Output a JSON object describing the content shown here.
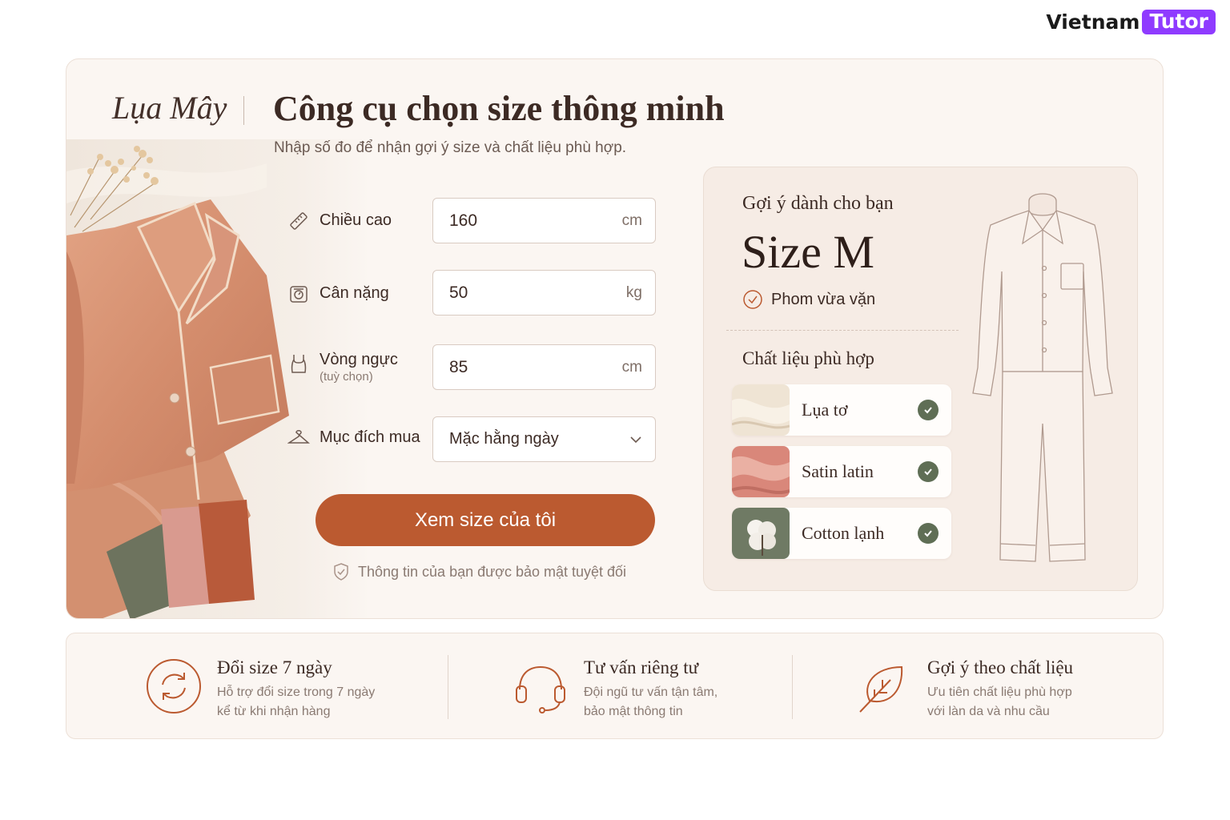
{
  "watermark": {
    "part1": "Vietnam",
    "part2": "Tutor"
  },
  "brand": "Lụa Mây",
  "header": {
    "title": "Công cụ chọn size thông minh",
    "subtitle": "Nhập số đo để nhận gợi ý size và chất liệu phù hợp."
  },
  "form": {
    "height": {
      "label": "Chiều cao",
      "value": "160",
      "unit": "cm",
      "icon": "ruler-icon"
    },
    "weight": {
      "label": "Cân nặng",
      "value": "50",
      "unit": "kg",
      "icon": "scale-icon"
    },
    "bust": {
      "label": "Vòng ngực",
      "sublabel": "(tuỳ chọn)",
      "value": "85",
      "unit": "cm",
      "icon": "tank-top-icon"
    },
    "purpose": {
      "label": "Mục đích mua",
      "value": "Mặc hằng ngày",
      "icon": "hanger-icon"
    },
    "submit_label": "Xem size của tôi",
    "privacy_note": "Thông tin của bạn được bảo mật tuyệt đối"
  },
  "recommendation": {
    "heading": "Gợi ý dành cho bạn",
    "size": "Size M",
    "fit": "Phom vừa vặn",
    "materials_heading": "Chất liệu phù hợp",
    "materials": [
      {
        "name": "Lụa tơ",
        "color": "#efe4d4"
      },
      {
        "name": "Satin latin",
        "color": "#d9877a"
      },
      {
        "name": "Cotton lạnh",
        "color": "#6f7a64"
      }
    ]
  },
  "features": [
    {
      "title": "Đổi size 7 ngày",
      "desc1": "Hỗ trợ đổi size trong 7 ngày",
      "desc2": "kể từ khi nhận hàng",
      "icon": "exchange-icon"
    },
    {
      "title": "Tư vấn riêng tư",
      "desc1": "Đội ngũ tư vấn tận tâm,",
      "desc2": "bảo mật thông tin",
      "icon": "headset-icon"
    },
    {
      "title": "Gợi ý theo chất liệu",
      "desc1": "Ưu tiên chất liệu phù hợp",
      "desc2": "với làn da và nhu cầu",
      "icon": "leaf-icon"
    }
  ],
  "colors": {
    "accent": "#bb5a30",
    "check": "#5f6e55",
    "background": "#fbf6f2",
    "panel": "#f6ece5"
  }
}
